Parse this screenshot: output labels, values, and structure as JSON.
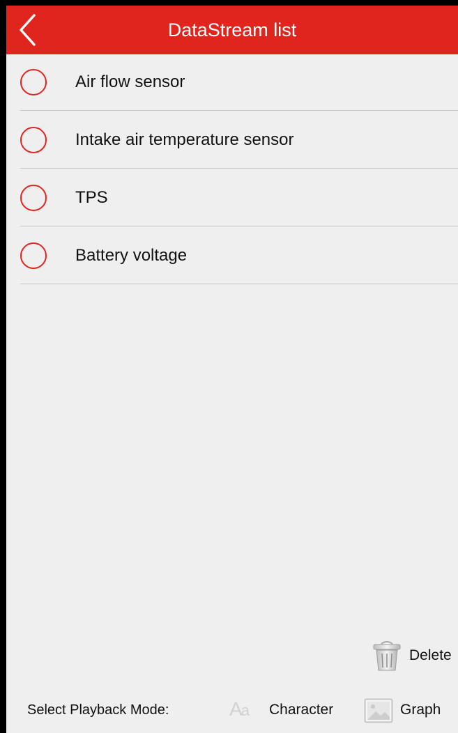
{
  "header": {
    "title": "DataStream list",
    "background_color": "#e0241e",
    "back_icon": "chevron-left-icon"
  },
  "list": {
    "items": [
      {
        "label": "Air flow sensor",
        "selected": false
      },
      {
        "label": "Intake air temperature sensor",
        "selected": false
      },
      {
        "label": "TPS",
        "selected": false
      },
      {
        "label": "Battery voltage",
        "selected": false
      }
    ],
    "radio_color": "#e0241e"
  },
  "actions": {
    "delete_label": "Delete",
    "delete_icon": "trash-icon"
  },
  "footer": {
    "prompt": "Select Playback Mode:",
    "character_label": "Character",
    "character_icon": "font-icon",
    "graph_label": "Graph",
    "graph_icon": "image-icon"
  }
}
